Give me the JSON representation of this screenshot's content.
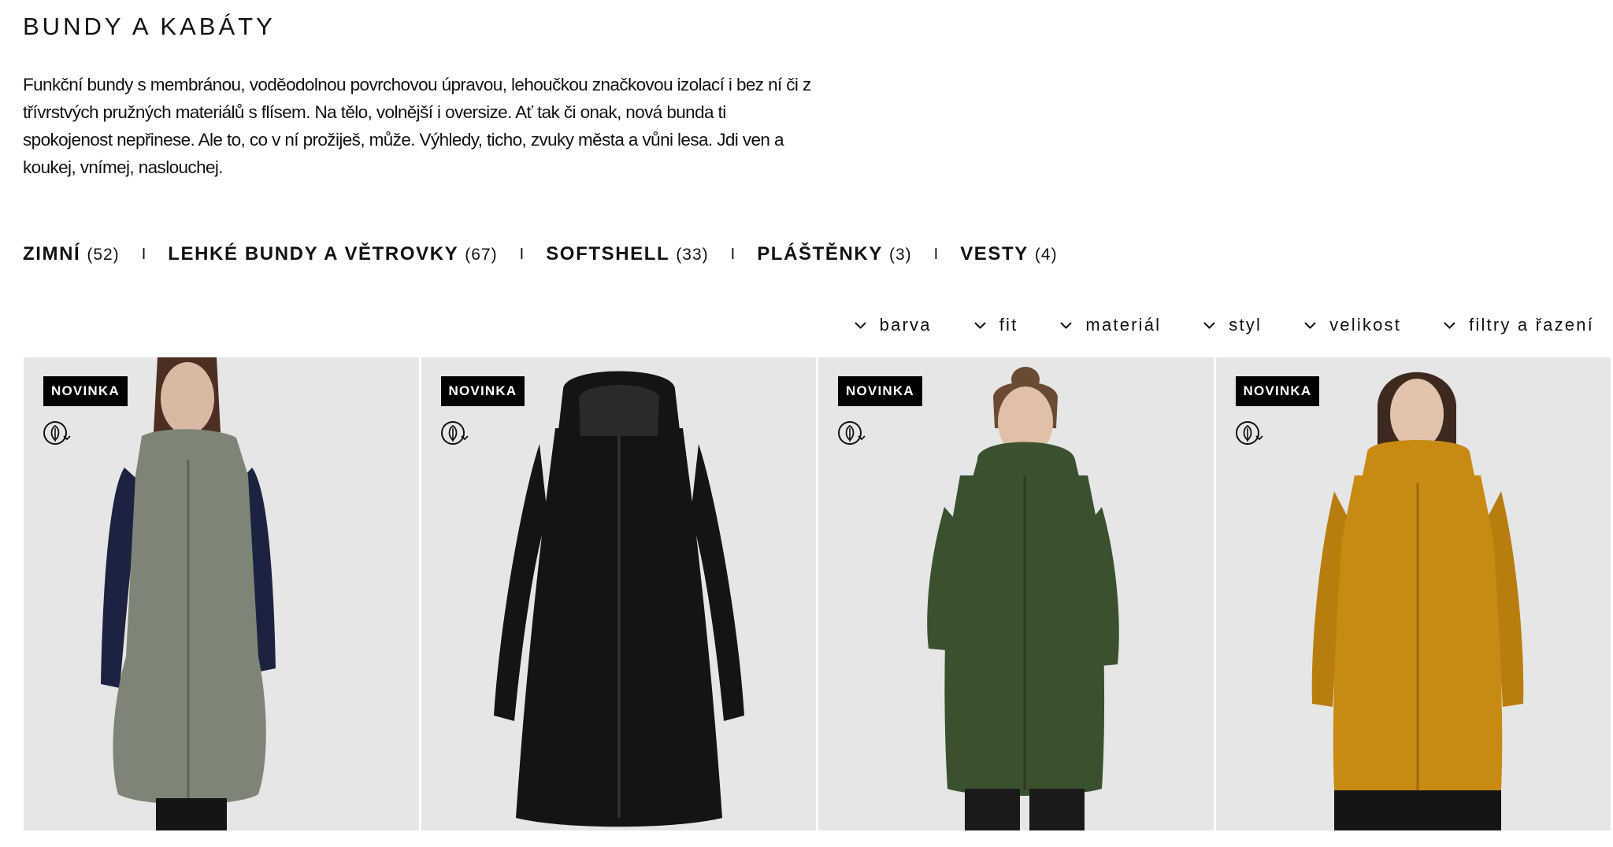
{
  "page": {
    "title": "BUNDY A KABÁTY",
    "intro": "Funkční bundy s membránou, voděodolnou povrchovou úpravou, lehoučkou značkovou izolací i bez ní či z třívrstvých pružných materiálů s flísem. Na tělo, volnější i oversize. Ať tak či onak, nová bunda ti spokojenost nepřinese. Ale to, co v ní prožiješ, může. Výhledy, ticho, zvuky města a vůni lesa. Jdi ven a koukej, vnímej, naslouchej."
  },
  "categories": [
    {
      "name": "ZIMNÍ",
      "count": "(52)"
    },
    {
      "name": "LEHKÉ BUNDY A VĚTROVKY",
      "count": "(67)"
    },
    {
      "name": "SOFTSHELL",
      "count": "(33)"
    },
    {
      "name": "PLÁŠTĚNKY",
      "count": "(3)"
    },
    {
      "name": "VESTY",
      "count": "(4)"
    }
  ],
  "category_separator": "I",
  "filters": [
    {
      "label": "barva",
      "icon": "chevron-down-icon"
    },
    {
      "label": "fit",
      "icon": "chevron-down-icon"
    },
    {
      "label": "materiál",
      "icon": "chevron-down-icon"
    },
    {
      "label": "styl",
      "icon": "chevron-down-icon"
    },
    {
      "label": "velikost",
      "icon": "chevron-down-icon"
    },
    {
      "label": "filtry a řazení",
      "icon": "chevron-down-icon"
    }
  ],
  "products": [
    {
      "badge": "NOVINKA",
      "icon": "eco-leaf-icon",
      "color": "#7f8576",
      "sleeve": "#1c2340",
      "skin": "#d9b9a4",
      "hair": "#4a2f22"
    },
    {
      "badge": "NOVINKA",
      "icon": "eco-leaf-icon",
      "color": "#141414",
      "sleeve": "#141414",
      "skin": "",
      "hair": ""
    },
    {
      "badge": "NOVINKA",
      "icon": "eco-leaf-icon",
      "color": "#3a5130",
      "sleeve": "#3a5130",
      "skin": "#e2c0a8",
      "hair": "#6b4a35"
    },
    {
      "badge": "NOVINKA",
      "icon": "eco-leaf-icon",
      "color": "#c98a12",
      "sleeve": "#c98a12",
      "skin": "#e4c3ad",
      "hair": "#3d2a1f"
    }
  ],
  "colors": {
    "badge_bg": "#000000",
    "card_bg": "#e6e6e6",
    "text": "#111111"
  }
}
